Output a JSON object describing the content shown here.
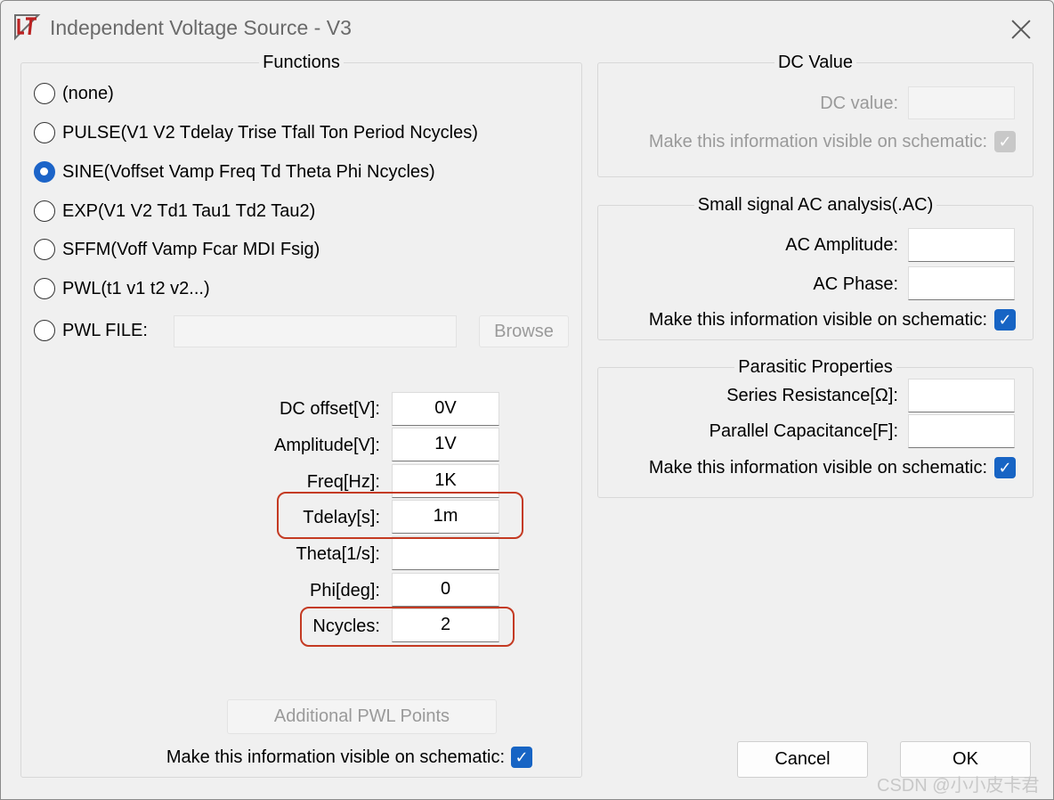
{
  "window": {
    "title": "Independent Voltage Source - V3"
  },
  "functions": {
    "legend": "Functions",
    "options": [
      {
        "label": "(none)",
        "selected": false
      },
      {
        "label": "PULSE(V1 V2 Tdelay Trise Tfall Ton Period Ncycles)",
        "selected": false
      },
      {
        "label": "SINE(Voffset Vamp Freq Td Theta Phi Ncycles)",
        "selected": true
      },
      {
        "label": "EXP(V1 V2 Td1 Tau1 Td2 Tau2)",
        "selected": false
      },
      {
        "label": "SFFM(Voff Vamp Fcar MDI Fsig)",
        "selected": false
      },
      {
        "label": "PWL(t1 v1 t2 v2...)",
        "selected": false
      },
      {
        "label": "PWL FILE:",
        "selected": false
      }
    ],
    "pwl_file_value": "",
    "browse_label": "Browse",
    "params": [
      {
        "label": "DC offset[V]:",
        "value": "0V"
      },
      {
        "label": "Amplitude[V]:",
        "value": "1V"
      },
      {
        "label": "Freq[Hz]:",
        "value": "1K"
      },
      {
        "label": "Tdelay[s]:",
        "value": "1m"
      },
      {
        "label": "Theta[1/s]:",
        "value": ""
      },
      {
        "label": "Phi[deg]:",
        "value": "0"
      },
      {
        "label": "Ncycles:",
        "value": "2"
      }
    ],
    "pwl_points_label": "Additional PWL Points",
    "visible_label": "Make this information visible on schematic:",
    "visible_checked": true
  },
  "dc": {
    "legend": "DC Value",
    "value_label": "DC value:",
    "value": "",
    "visible_label": "Make this information visible on schematic:",
    "visible_checked": true
  },
  "ac": {
    "legend": "Small signal AC analysis(.AC)",
    "amplitude_label": "AC Amplitude:",
    "amplitude": "",
    "phase_label": "AC Phase:",
    "phase": "",
    "visible_label": "Make this information visible on schematic:",
    "visible_checked": true
  },
  "parasitic": {
    "legend": "Parasitic Properties",
    "resistance_label": "Series Resistance[Ω]:",
    "resistance": "",
    "capacitance_label": "Parallel Capacitance[F]:",
    "capacitance": "",
    "visible_label": "Make this information visible on schematic:",
    "visible_checked": true
  },
  "buttons": {
    "cancel": "Cancel",
    "ok": "OK"
  },
  "watermark": "CSDN @小小皮卡君",
  "icons": {
    "check": "✓"
  },
  "colors": {
    "accent": "#1764c4",
    "highlight": "#c43a22"
  }
}
